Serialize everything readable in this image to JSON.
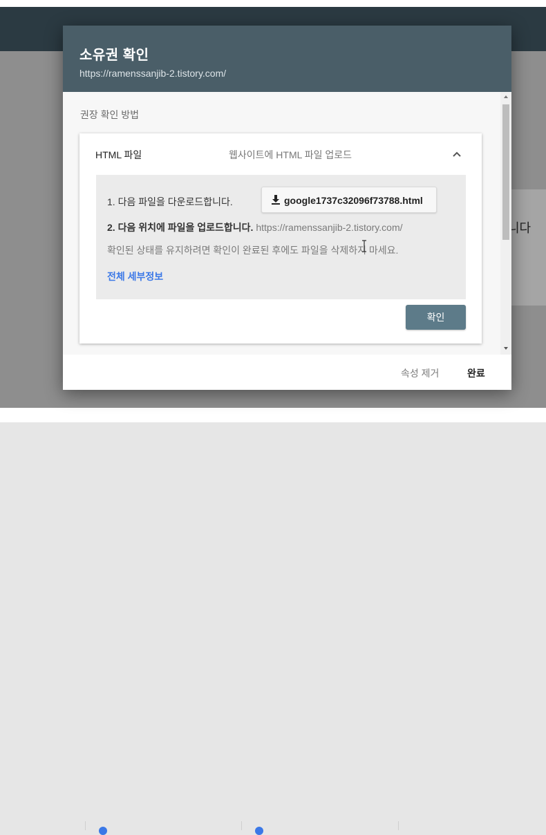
{
  "dialog": {
    "title": "소유권 확인",
    "url": "https://ramenssanjib-2.tistory.com/"
  },
  "section_label": "권장 확인 방법",
  "method": {
    "name": "HTML 파일",
    "description": "웹사이트에 HTML 파일 업로드",
    "expand_icon": "chevron-up-icon",
    "step1_text": "1. 다음 파일을 다운로드합니다.",
    "download_icon": "download-icon",
    "download_label": "google1737c32096f73788.html",
    "step2_bold": "2. 다음 위치에 파일을 업로드합니다.",
    "step2_url": "https://ramenssanjib-2.tistory.com/",
    "note": "확인된 상태를 유지하려면 확인이 완료된 후에도 파일을 삭제하지 마세요.",
    "details_link": "전체 세부정보",
    "confirm_label": "확인"
  },
  "footer": {
    "remove_label": "속성 제거",
    "done_label": "완료"
  },
  "background": {
    "card_text": "니다"
  },
  "colors": {
    "header": "#4a5e68",
    "confirm_button": "#5d7b89",
    "link": "#3b78e7"
  }
}
